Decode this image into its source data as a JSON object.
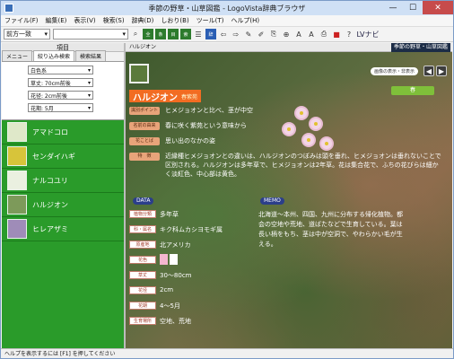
{
  "window": {
    "title": "季節の野草・山草図鑑 - LogoVista辞典ブラウザ"
  },
  "menu": [
    "ファイル(F)",
    "編集(E)",
    "表示(V)",
    "検索(S)",
    "辞典(D)",
    "しおり(B)",
    "ツール(T)",
    "ヘルプ(H)"
  ],
  "toolbar": {
    "search_mode": "前方一致",
    "search_value": "",
    "logo": "LVナビ"
  },
  "left": {
    "header": "項目",
    "tabs": [
      "メニュー",
      "絞り込み検索",
      "検索結果"
    ],
    "filters": [
      {
        "label": "",
        "value": "白色系"
      },
      {
        "label": "",
        "value": "草丈: 70cm前後"
      },
      {
        "label": "",
        "value": "花径: 2cm前後"
      },
      {
        "label": "",
        "value": "花期: 5月"
      }
    ],
    "items": [
      "アマドコロ",
      "センダイハギ",
      "ナルコユリ",
      "ハルジオン",
      "ヒレアザミ"
    ]
  },
  "right": {
    "header": "ハルジオン",
    "badge": "季節の野草・山草図鑑",
    "source_button": "画像の表示・非表示",
    "season": "春",
    "name": "ハルジオン",
    "family": "春紫苑",
    "tags": [
      {
        "label": "識別ポイント",
        "text": "ヒメジョオンと比べ、茎が中空"
      },
      {
        "label": "名前の由来",
        "text": "春に咲く紫苑という意味から"
      },
      {
        "label": "花ことば",
        "text": "思い出のなかの姿"
      },
      {
        "label": "特　徴",
        "text": "近縁種ヒメジョオンとの違いは、ハルジオンのつぼみは頭を垂れ、ヒメジョオンは垂れないことで区別される。ハルジオンは多年草で、ヒメジョオンは2年草。花は集合花で、ふちの花びらは細かく淡紅色、中心部は黄色。"
      }
    ],
    "data_title": "DATA",
    "data": [
      {
        "label": "植物分類",
        "value": "多年草"
      },
      {
        "label": "科・属名",
        "value": "キク科ムカシヨモギ属"
      },
      {
        "label": "原産地",
        "value": "北アメリカ"
      },
      {
        "label": "花色",
        "value": ""
      },
      {
        "label": "草丈",
        "value": "30〜80cm"
      },
      {
        "label": "花径",
        "value": "2cm"
      },
      {
        "label": "花期",
        "value": "4〜5月"
      },
      {
        "label": "生育場所",
        "value": "空地、荒地"
      }
    ],
    "flower_colors": [
      "#f4b6cf",
      "#ffffff"
    ],
    "memo_title": "MEMO",
    "memo": "北海道〜本州、四国、九州に分布する帰化植物。都会の空地や荒地、道ばたなどで生育している。葉は長い柄をもち、茎は中が空洞で、やわらかい毛が生える。"
  },
  "status": "ヘルプを表示するには [F1] を押してください"
}
